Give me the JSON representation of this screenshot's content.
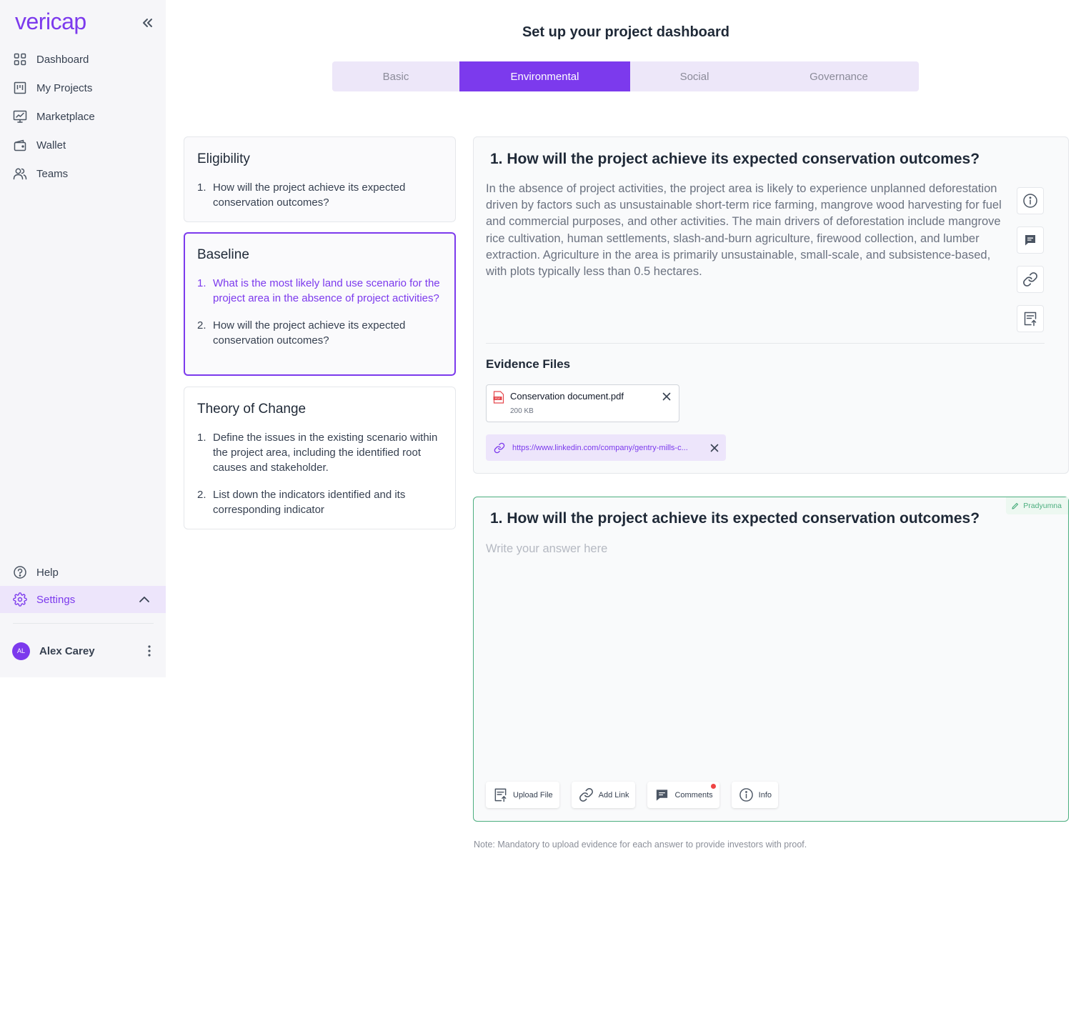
{
  "app": {
    "logo": "vericap"
  },
  "sidebar": {
    "items": [
      {
        "label": "Dashboard",
        "icon": "dashboard-grid-icon"
      },
      {
        "label": "My Projects",
        "icon": "projects-board-icon"
      },
      {
        "label": "Marketplace",
        "icon": "marketplace-monitor-icon"
      },
      {
        "label": "Wallet",
        "icon": "wallet-icon"
      },
      {
        "label": "Teams",
        "icon": "teams-users-icon"
      }
    ],
    "bottom_items": [
      {
        "label": "Help",
        "icon": "help-circle-icon"
      },
      {
        "label": "Settings",
        "icon": "gear-icon",
        "active": true
      }
    ],
    "user": {
      "initials": "AL",
      "name": "Alex Carey"
    }
  },
  "header": {
    "title": "Set up your project dashboard",
    "tabs": [
      {
        "label": "Basic"
      },
      {
        "label": "Environmental",
        "active": true
      },
      {
        "label": "Social"
      },
      {
        "label": "Governance"
      }
    ]
  },
  "sections": [
    {
      "title": "Eligibility",
      "questions": [
        {
          "num": "1.",
          "text": "How will the project achieve its expected conservation outcomes?"
        }
      ]
    },
    {
      "title": "Baseline",
      "selected": true,
      "questions": [
        {
          "num": "1.",
          "text": "What is the most likely land use scenario for the project area in the absence of project activities?",
          "highlighted": true
        },
        {
          "num": "2.",
          "text": "How will the project achieve its expected conservation outcomes?"
        }
      ]
    },
    {
      "title": "Theory of Change",
      "questions": [
        {
          "num": "1.",
          "text": "Define the issues in the existing scenario within the project area, including the identified root causes and stakeholder."
        },
        {
          "num": "2.",
          "text": "List down the indicators identified and its corresponding indicator"
        }
      ]
    }
  ],
  "question_panel": {
    "title": "1. How will the project achieve its expected conservation outcomes?",
    "body": "In the absence of project activities, the project area is likely to experience unplanned deforestation driven by factors such as unsustainable short-term rice farming, mangrove wood harvesting for fuel and commercial purposes, and other activities. The main drivers of deforestation include mangrove rice cultivation, human settlements, slash-and-burn agriculture, firewood collection, and lumber extraction. Agriculture in the area is primarily unsustainable, small-scale, and subsistence-based, with plots typically less than 0.5 hectares.",
    "evidence_title": "Evidence Files",
    "file": {
      "name": "Conservation document.pdf",
      "size": "200 KB"
    },
    "link": "https://www.linkedin.com/company/gentry-mills-c..."
  },
  "answer_panel": {
    "editor": "Pradyumna",
    "title": "1. How will the project achieve its expected conservation outcomes?",
    "placeholder": "Write your answer here",
    "actions": {
      "upload": "Upload File",
      "link": "Add Link",
      "comments": "Comments",
      "info": "Info"
    }
  },
  "note": "Note: Mandatory to upload evidence for each answer to provide investors with proof.",
  "colors": {
    "accent": "#7c3aed",
    "success": "#4cae7f",
    "alert": "#ef4444"
  }
}
